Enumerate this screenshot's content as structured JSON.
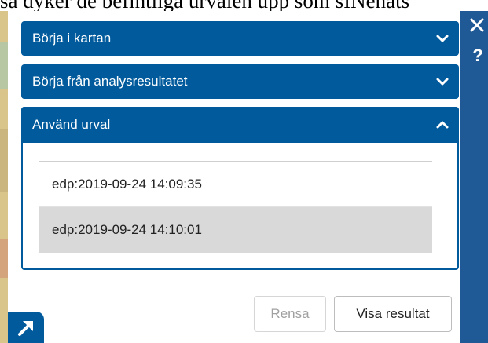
{
  "background_text": "så dyker de befintliga urvalen upp som sINenats",
  "accordion": {
    "sections": [
      {
        "label": "Börja i kartan",
        "expanded": false,
        "icon": "chevron-down-icon"
      },
      {
        "label": "Börja från analysresultatet",
        "expanded": false,
        "icon": "chevron-down-icon"
      },
      {
        "label": "Använd urval",
        "expanded": true,
        "icon": "chevron-up-icon"
      }
    ]
  },
  "selections": [
    {
      "label": "edp:2019-09-24 14:09:35",
      "selected": false
    },
    {
      "label": "edp:2019-09-24 14:10:01",
      "selected": true
    }
  ],
  "footer": {
    "clear_label": "Rensa",
    "clear_disabled": true,
    "show_label": "Visa resultat"
  },
  "side_toolbar": {
    "close_icon": "close-icon",
    "help_label": "?"
  },
  "expand_icon": "expand-arrow-icon",
  "colors": {
    "accent": "#005a9c",
    "selected_row": "#d9d9d9",
    "side_bar": "#1f5a96"
  }
}
